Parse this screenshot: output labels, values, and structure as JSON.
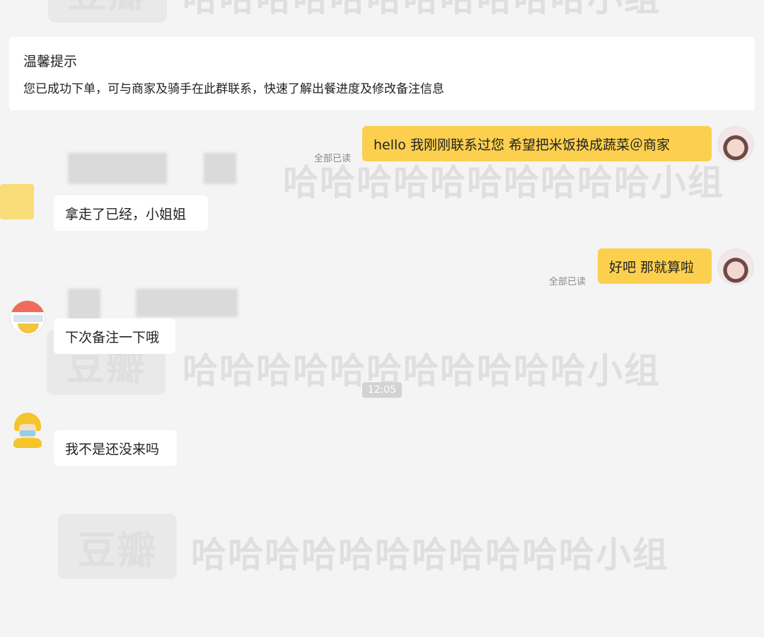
{
  "notice": {
    "title": "温馨提示",
    "body": "您已成功下单，可与商家及骑手在此群联系，快速了解出餐进度及修改备注信息"
  },
  "messages": [
    {
      "sender": "me",
      "text": "hello 我刚刚联系过您 希望把米饭换成蔬菜＠商家",
      "read_status": "全部已读"
    },
    {
      "sender": "other",
      "text": "拿走了已经，小姐姐"
    },
    {
      "sender": "me",
      "text": "好吧 那就算啦",
      "read_status": "全部已读"
    },
    {
      "sender": "merchant",
      "text": "下次备注一下哦"
    },
    {
      "sender": "rider",
      "text": "我不是还没来吗"
    }
  ],
  "timestamp": "12:05",
  "watermark": {
    "logo": "豆瓣",
    "text": "哈哈哈哈哈哈哈哈哈哈哈小组",
    "text_short": "哈哈哈哈哈哈哈哈哈哈小组"
  }
}
